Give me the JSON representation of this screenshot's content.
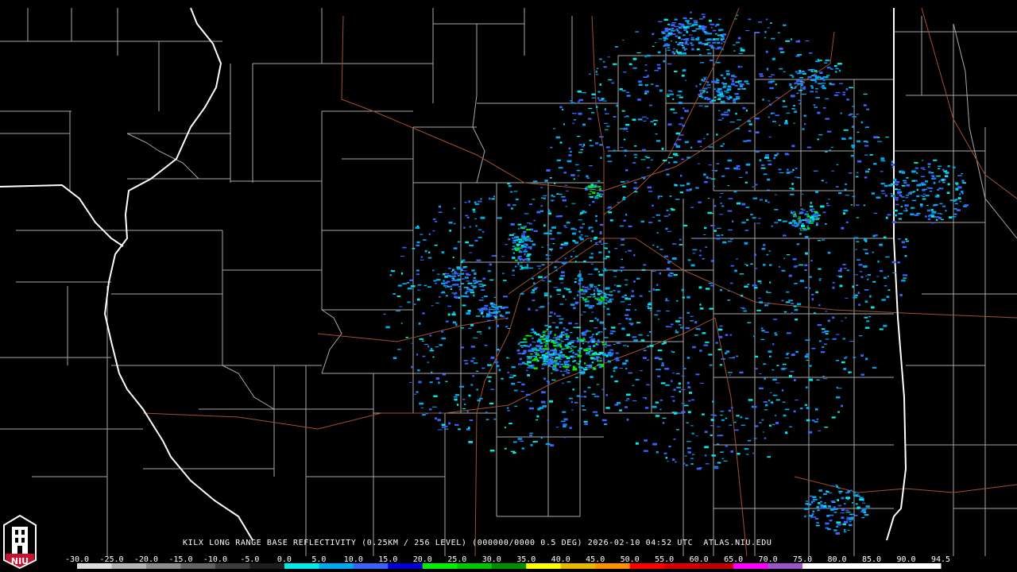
{
  "title": "KILX LONG RANGE BASE REFLECTIVITY (0.25KM / 256 LEVEL) (000000/0000 0.5 DEG) 2026-02-10 04:52 UTC  ATLAS.NIU.EDU",
  "logo_text": "NIU",
  "scale": {
    "labels": [
      "-30.0",
      "-25.0",
      "-20.0",
      "-15.0",
      "-10.0",
      "-5.0",
      "0.0",
      "5.0",
      "10.0",
      "15.0",
      "20.0",
      "25.0",
      "30.0",
      "35.0",
      "40.0",
      "45.0",
      "50.0",
      "55.0",
      "60.0",
      "65.0",
      "70.0",
      "75.0",
      "80.0",
      "85.0",
      "90.0",
      "94.5"
    ],
    "colors": [
      "#dcdcdc",
      "#b4b4b4",
      "#8c8c8c",
      "#646464",
      "#3c3c3c",
      "#1e1e1e",
      "#00eaea",
      "#00a8f0",
      "#3a62ff",
      "#0000d6",
      "#00f000",
      "#00c800",
      "#009000",
      "#ffff00",
      "#e6b800",
      "#ff9000",
      "#ff0000",
      "#d60000",
      "#c00000",
      "#ff00ff",
      "#9955c9",
      "#ffffff",
      "#ffffff",
      "#ffffff",
      "#ffffff"
    ]
  },
  "colors": {
    "county_line": "#b4b4b4",
    "state_line": "#ffffff",
    "highway": "#a0522d",
    "background": "#000000"
  }
}
